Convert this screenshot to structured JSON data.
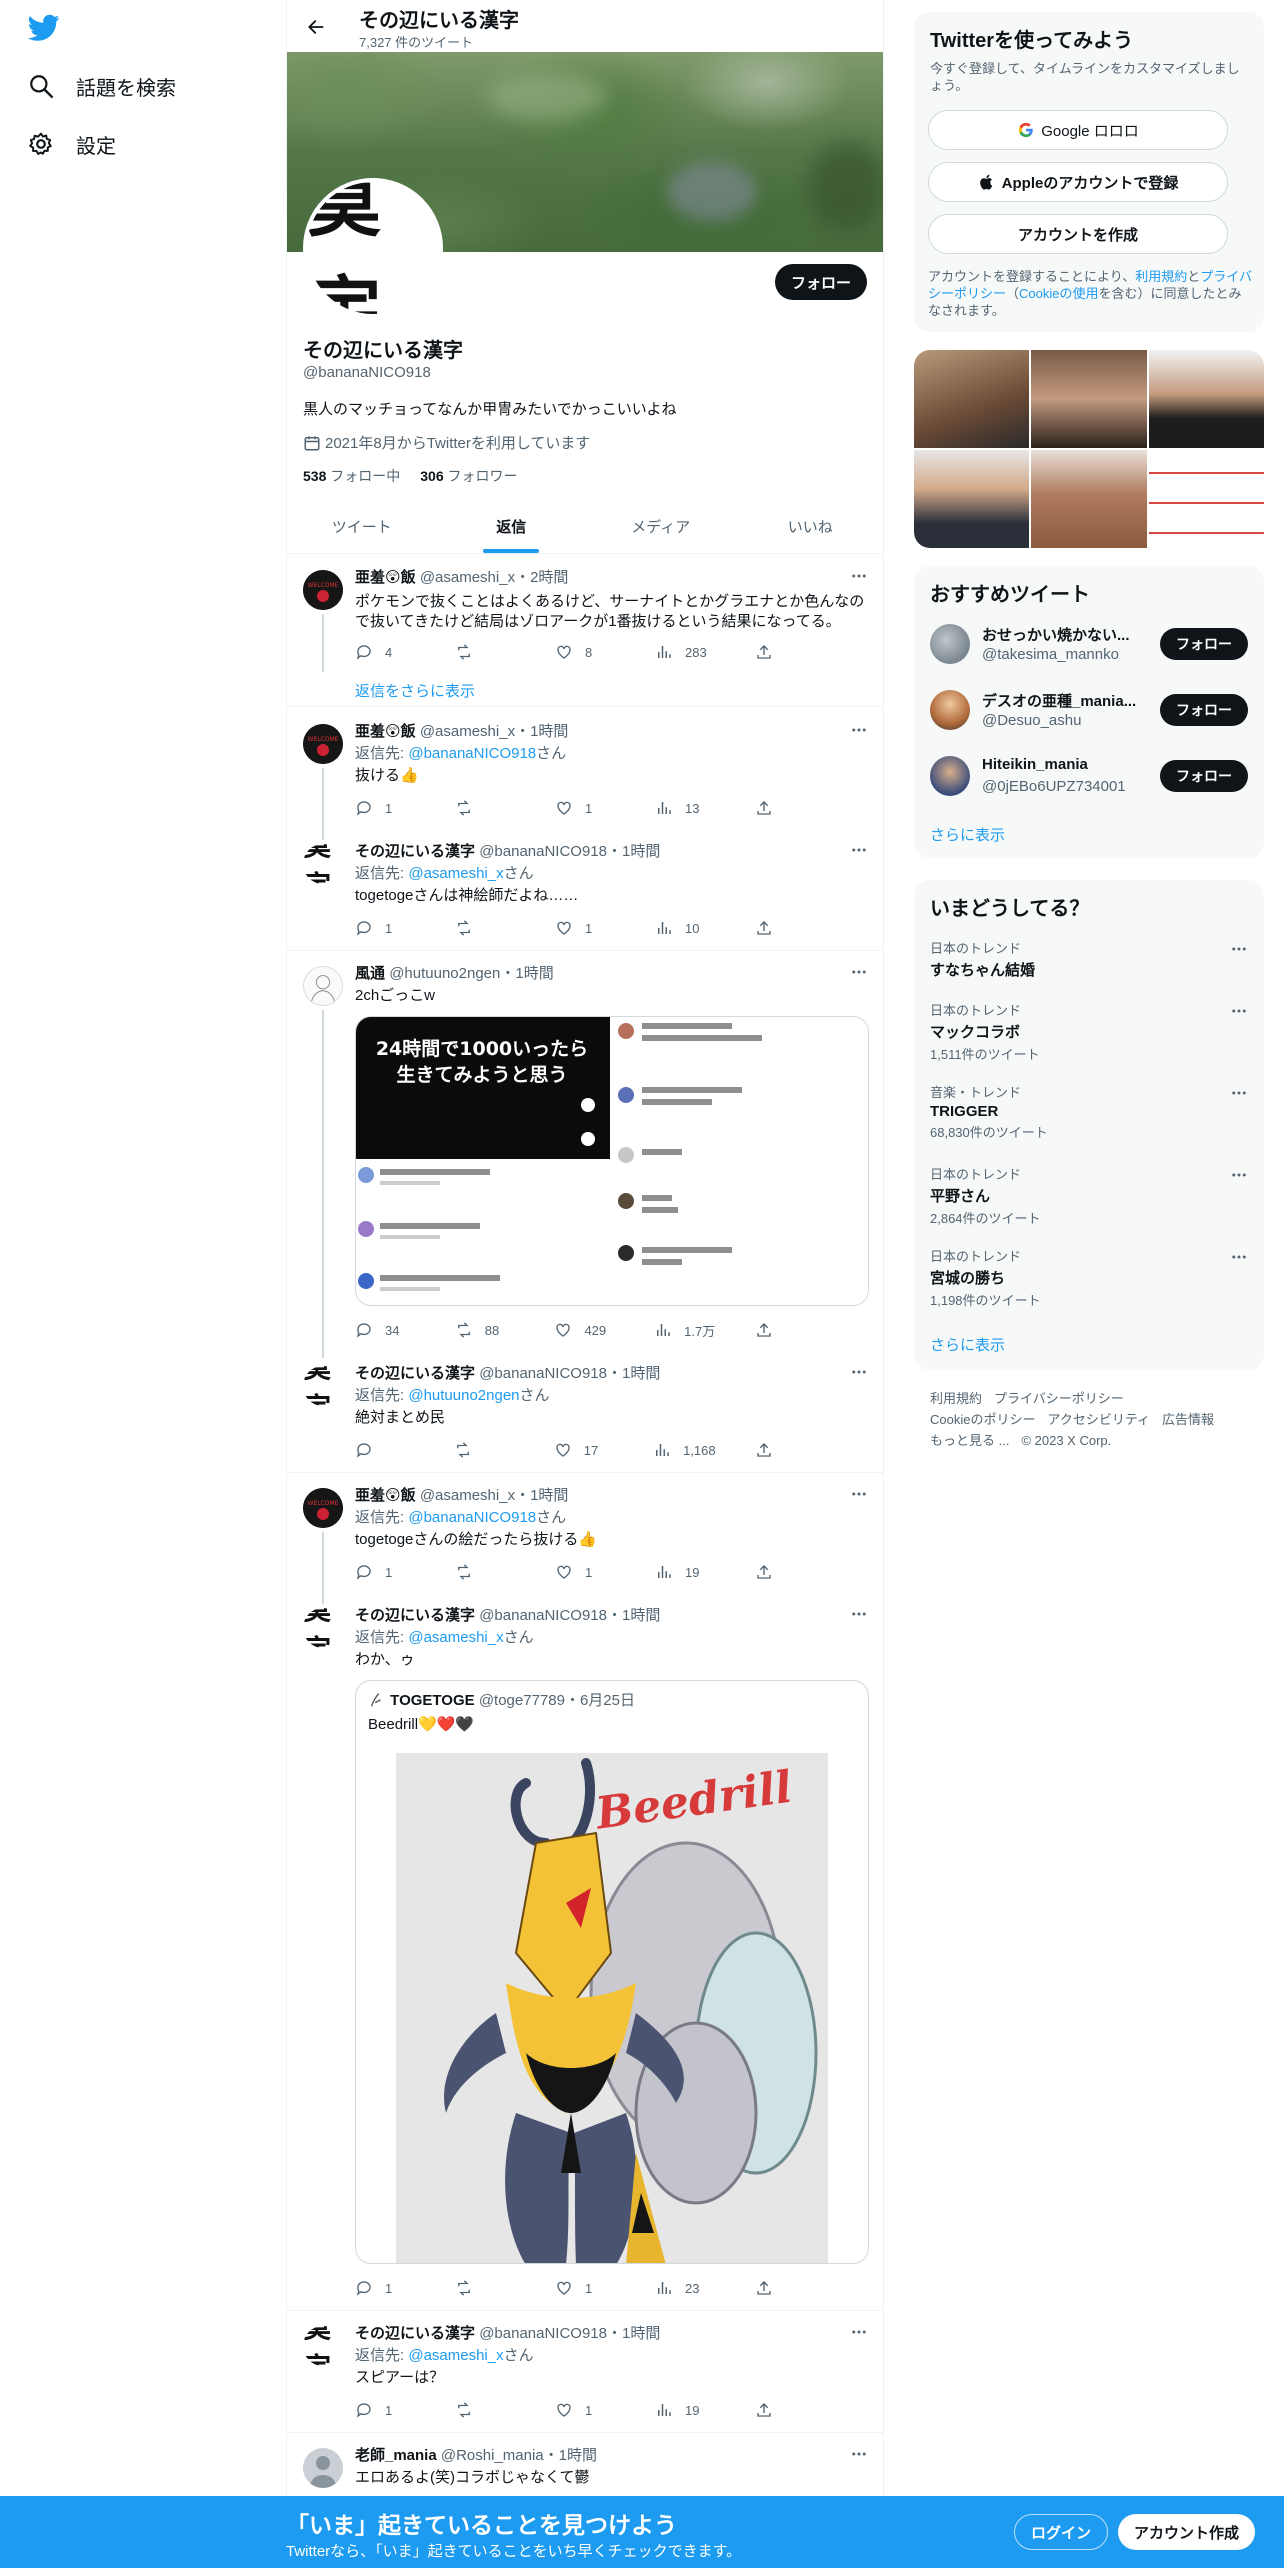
{
  "nav": {
    "items": [
      {
        "label": "話題を検索",
        "icon": "search-icon"
      },
      {
        "label": "設定",
        "icon": "gear-icon"
      }
    ]
  },
  "header": {
    "name": "その辺にいる漢字",
    "tweet_count": "7,327 件のツイート"
  },
  "profile": {
    "avatar_text": "莫宇",
    "follow_label": "フォロー",
    "name": "その辺にいる漢字",
    "handle": "@bananaNICO918",
    "bio": "黒人のマッチョってなんか甲冑みたいでかっこいいよね",
    "joined": "2021年8月からTwitterを利用しています",
    "following_count": "538",
    "following_label": " フォロー中",
    "followers_count": "306",
    "followers_label": " フォロワー"
  },
  "tabs": [
    {
      "label": "ツイート",
      "active": false
    },
    {
      "label": "返信",
      "active": true
    },
    {
      "label": "メディア",
      "active": false
    },
    {
      "label": "いいね",
      "active": false
    }
  ],
  "tweets": [
    {
      "name": "亜羞😲飯",
      "handle": "@asameshi_x",
      "time": "・2時間",
      "lines": [
        "ポケモンで抜くことはよくあるけど、サーナイトとかグラエナとか色んなの",
        "で抜いてきたけど結局はゾロアークが1番抜けるという結果になってる。"
      ],
      "reply": "4",
      "retweet": "",
      "like": "8",
      "views": "283"
    },
    {
      "show_more": "返信をさらに表示"
    },
    {
      "name": "亜羞😲飯",
      "handle": "@asameshi_x",
      "time": "・1時間",
      "reply_to_prefix": "返信先: ",
      "reply_to": "@bananaNICO918",
      "reply_to_suffix": "さん",
      "text": "抜ける👍",
      "reply": "1",
      "retweet": "",
      "like": "1",
      "views": "13"
    },
    {
      "name": "その辺にいる漢字",
      "handle": "@bananaNICO918",
      "time": "・1時間",
      "reply_to_prefix": "返信先: ",
      "reply_to": "@asameshi_x",
      "reply_to_suffix": "さん",
      "text": "togetogeさんは神絵師だよね……",
      "reply": "1",
      "retweet": "",
      "like": "1",
      "views": "10"
    },
    {
      "name": "風通",
      "handle": "@hutuuno2ngen",
      "time": "・1時間",
      "text": "2chごっこw",
      "media_title_1": "24時間で1000いったら",
      "media_title_2": "生きてみようと思う",
      "reply": "34",
      "retweet": "88",
      "like": "429",
      "views": "1.7万"
    },
    {
      "name": "その辺にいる漢字",
      "handle": "@bananaNICO918",
      "time": "・1時間",
      "reply_to_prefix": "返信先: ",
      "reply_to": "@hutuuno2ngen",
      "reply_to_suffix": "さん",
      "text": "絶対まとめ民",
      "reply": "",
      "retweet": "",
      "like": "17",
      "views": "1,168"
    },
    {
      "name": "亜羞😲飯",
      "handle": "@asameshi_x",
      "time": "・1時間",
      "reply_to_prefix": "返信先: ",
      "reply_to": "@bananaNICO918",
      "reply_to_suffix": "さん",
      "text": "togetogeさんの絵だったら抜ける👍",
      "reply": "1",
      "retweet": "",
      "like": "1",
      "views": "19"
    },
    {
      "name": "その辺にいる漢字",
      "handle": "@bananaNICO918",
      "time": "・1時間",
      "reply_to_prefix": "返信先: ",
      "reply_to": "@asameshi_x",
      "reply_to_suffix": "さん",
      "text": "わか、ゥ",
      "quote_name": "TOGETOGE",
      "quote_handle": "@toge77789",
      "quote_time": "・6月25日",
      "quote_text": "Beedrill💛❤️🖤",
      "art_title": "Beedrill",
      "reply": "1",
      "retweet": "",
      "like": "1",
      "views": "23"
    },
    {
      "name": "その辺にいる漢字",
      "handle": "@bananaNICO918",
      "time": "・1時間",
      "reply_to_prefix": "返信先: ",
      "reply_to": "@asameshi_x",
      "reply_to_suffix": "さん",
      "text": "スピアーは？",
      "reply": "1",
      "retweet": "",
      "like": "1",
      "views": "19"
    },
    {
      "name": "老師_mania",
      "handle": "@Roshi_mania",
      "time": "・1時間",
      "text": "エロあるよ(笑)コラボじゃなくて鬱"
    }
  ],
  "signup_panel": {
    "title": "Twitterを使ってみよう",
    "subtitle": "今すぐ登録して、タイムラインをカスタマイズしましょう。",
    "google_label": "Google ロロロ",
    "apple_label": "Appleのアカウントで登録",
    "create_label": "アカウントを作成",
    "legal_1": "アカウントを登録することにより、",
    "legal_terms": "利用規約",
    "legal_2": "と",
    "legal_privacy": "プライバシーポリシー",
    "legal_3": "（",
    "legal_cookie": "Cookieの使用",
    "legal_4": "を含む）に同意したとみなされます。"
  },
  "who_to_follow": {
    "title": "おすすめツイート",
    "users": [
      {
        "name": "おせっかい焼かない...",
        "handle": "@takesima_mannko",
        "button": "フォロー"
      },
      {
        "name": "デスオの亜種_mania...",
        "handle": "@Desuo_ashu",
        "button": "フォロー"
      },
      {
        "name": "Hiteikin_mania",
        "handle": "@0jEBo6UPZ734001",
        "button": "フォロー"
      }
    ],
    "show_more": "さらに表示"
  },
  "trends": {
    "title": "いまどうしてる？",
    "items": [
      {
        "category": "日本のトレンド",
        "name": "すなちゃん結婚",
        "count": ""
      },
      {
        "category": "日本のトレンド",
        "name": "マックコラボ",
        "count": "1,511件のツイート"
      },
      {
        "category": "音楽・トレンド",
        "name": "TRIGGER",
        "count": "68,830件のツイート"
      },
      {
        "category": "日本のトレンド",
        "name": "平野さん",
        "count": "2,864件のツイート"
      },
      {
        "category": "日本のトレンド",
        "name": "宮城の勝ち",
        "count": "1,198件のツイート"
      }
    ],
    "show_more": "さらに表示"
  },
  "footer": {
    "links": [
      "利用規約",
      "プライバシーポリシー",
      "Cookieのポリシー",
      "アクセシビリティ",
      "広告情報",
      "もっと見る ...",
      "© 2023 X Corp."
    ]
  },
  "bottom_bar": {
    "title": "「いま」起きていることを見つけよう",
    "subtitle": "Twitterなら、「いま」起きていることをいち早くチェックできます。",
    "login": "ログイン",
    "signup": "アカウント作成"
  },
  "colors": {
    "accent": "#1d9bf0",
    "text": "#0f1419",
    "muted": "#536471",
    "bar": "#1d9bf0"
  }
}
